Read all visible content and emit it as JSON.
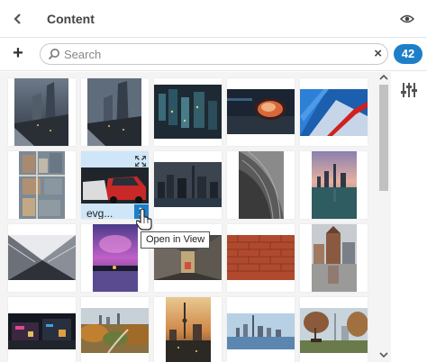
{
  "header": {
    "title": "Content",
    "back_icon": "chevron-left-icon",
    "visibility_icon": "eye-icon"
  },
  "toolbar": {
    "add_icon": "plus-icon",
    "add_label": "+",
    "search_placeholder": "Search",
    "search_value": "",
    "clear_label": "×",
    "count": "42"
  },
  "hover_tile": {
    "name": "evg...",
    "tooltip": "Open in View"
  },
  "colors": {
    "accent": "#1e7fc9",
    "hover_tile_bg": "#cfe6f8",
    "grid_bg": "#f4f4f4"
  },
  "filter_icon": "sliders-icon"
}
